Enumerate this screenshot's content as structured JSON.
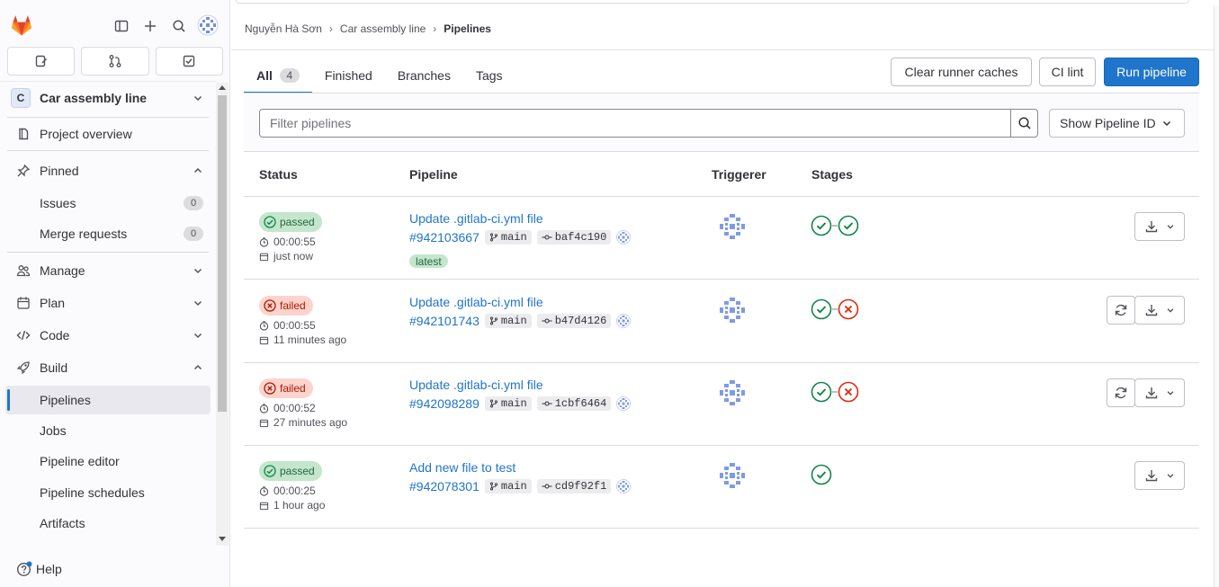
{
  "sidebar": {
    "project": {
      "initial": "C",
      "name": "Car assembly line"
    },
    "items": [
      {
        "label": "Project overview"
      },
      {
        "label": "Pinned"
      },
      {
        "label": "Issues",
        "count": "0"
      },
      {
        "label": "Merge requests",
        "count": "0"
      },
      {
        "label": "Manage"
      },
      {
        "label": "Plan"
      },
      {
        "label": "Code"
      },
      {
        "label": "Build"
      },
      {
        "label": "Pipelines"
      },
      {
        "label": "Jobs"
      },
      {
        "label": "Pipeline editor"
      },
      {
        "label": "Pipeline schedules"
      },
      {
        "label": "Artifacts"
      }
    ],
    "help_label": "Help"
  },
  "breadcrumb": {
    "user": "Nguyễn Hà Sơn",
    "project": "Car assembly line",
    "current": "Pipelines"
  },
  "tabs": [
    {
      "label": "All",
      "count": "4"
    },
    {
      "label": "Finished"
    },
    {
      "label": "Branches"
    },
    {
      "label": "Tags"
    }
  ],
  "actions": {
    "clear_caches": "Clear runner caches",
    "ci_lint": "CI lint",
    "run_pipeline": "Run pipeline"
  },
  "filter": {
    "placeholder": "Filter pipelines",
    "show_pipeline_id": "Show Pipeline ID"
  },
  "table": {
    "headers": {
      "status": "Status",
      "pipeline": "Pipeline",
      "triggerer": "Triggerer",
      "stages": "Stages"
    },
    "rows": [
      {
        "status": "passed",
        "duration": "00:00:55",
        "time": "just now",
        "title": "Update .gitlab-ci.yml file",
        "id": "#942103667",
        "branch": "main",
        "commit": "baf4c190",
        "latest": "latest",
        "stages": [
          "success",
          "success"
        ]
      },
      {
        "status": "failed",
        "duration": "00:00:55",
        "time": "11 minutes ago",
        "title": "Update .gitlab-ci.yml file",
        "id": "#942101743",
        "branch": "main",
        "commit": "b47d4126",
        "stages": [
          "success",
          "failed"
        ]
      },
      {
        "status": "failed",
        "duration": "00:00:52",
        "time": "27 minutes ago",
        "title": "Update .gitlab-ci.yml file",
        "id": "#942098289",
        "branch": "main",
        "commit": "1cbf6464",
        "stages": [
          "success",
          "failed"
        ]
      },
      {
        "status": "passed",
        "duration": "00:00:25",
        "time": "1 hour ago",
        "title": "Add new file to test",
        "id": "#942078301",
        "branch": "main",
        "commit": "cd9f92f1",
        "stages": [
          "success"
        ]
      }
    ]
  },
  "colors": {
    "accent": "#1f75cb",
    "success": "#108548",
    "danger": "#dd2b0e",
    "passed_bg": "#c3e6cd",
    "failed_bg": "#fdd4cd"
  }
}
